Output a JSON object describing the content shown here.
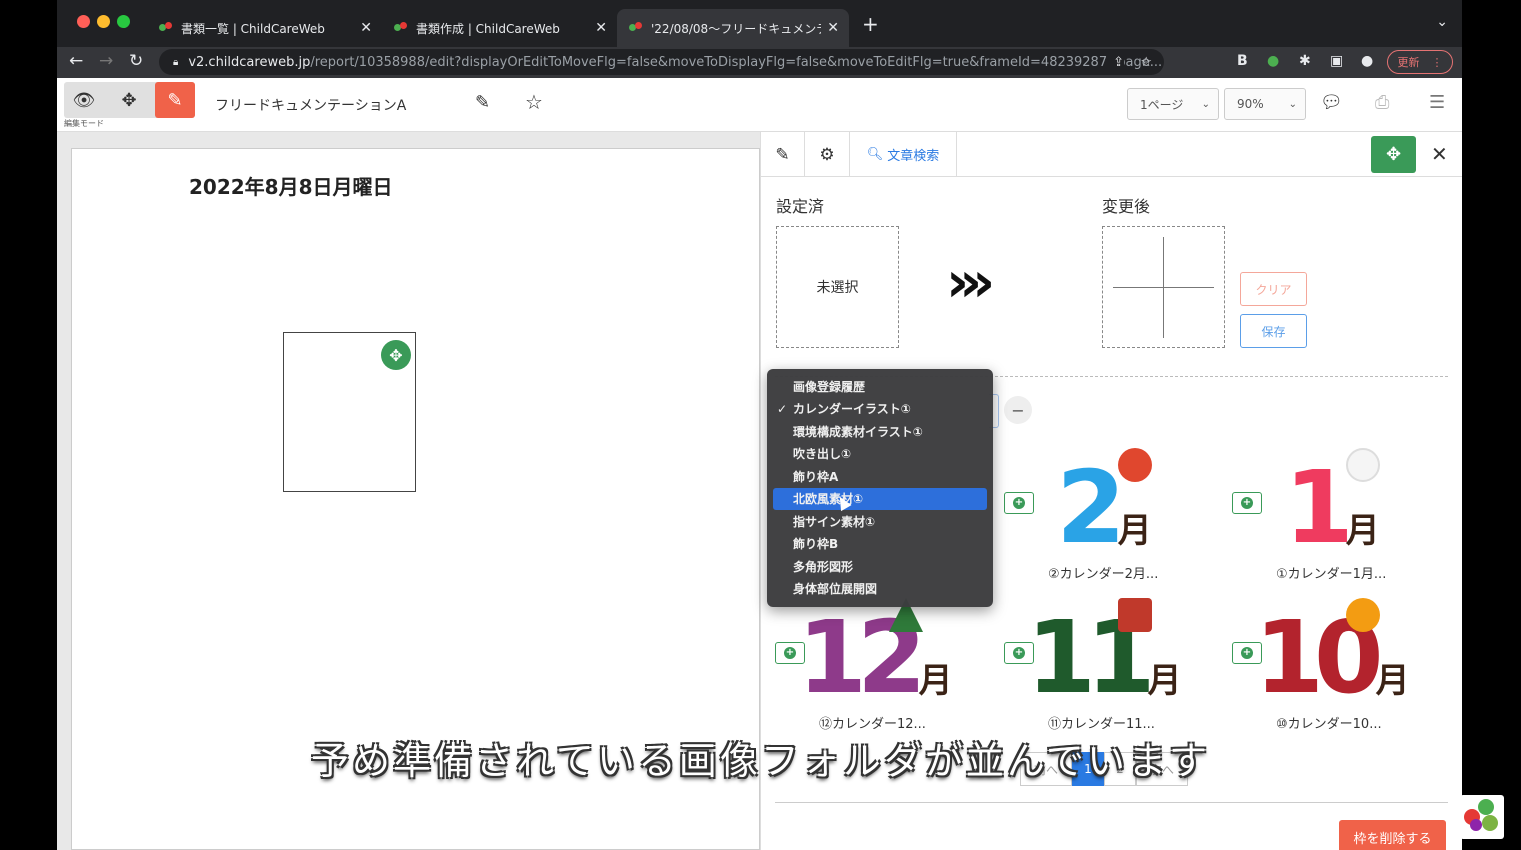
{
  "browser": {
    "tabs": [
      {
        "title": "書類一覧 | ChildCareWeb"
      },
      {
        "title": "書類作成 | ChildCareWeb"
      },
      {
        "title": "'22/08/08〜フリードキュメンテ"
      }
    ],
    "url_host": "v2.childcareweb.jp",
    "url_path": "/report/10358988/edit?displayOrEditToMoveFlg=false&moveToDisplayFlg=false&moveToEditFlg=true&frameId=48239287&page...",
    "update_label": "更新",
    "extensions": [
      "B"
    ]
  },
  "toolbar": {
    "mode_label": "編集モード",
    "doc_title": "フリードキュメンテーションA",
    "page_select": "1ページ",
    "zoom_select": "90%"
  },
  "canvas": {
    "date_heading": "2022年8月8日月曜日"
  },
  "panel": {
    "search_label": "文章検索",
    "set_label": "設定済",
    "after_label": "変更後",
    "unselected_label": "未選択",
    "arrows": "›››",
    "clear_label": "クリア",
    "save_label": "保存",
    "delete_frame_label": "枠を削除する"
  },
  "dropdown": {
    "items": [
      {
        "label": "画像登録履歴",
        "checked": false,
        "selected": false
      },
      {
        "label": "カレンダーイラスト①",
        "checked": true,
        "selected": false
      },
      {
        "label": "環境構成素材イラスト①",
        "checked": false,
        "selected": false
      },
      {
        "label": "吹き出し①",
        "checked": false,
        "selected": false
      },
      {
        "label": "飾り枠A",
        "checked": false,
        "selected": false
      },
      {
        "label": "北欧風素材①",
        "checked": false,
        "selected": true
      },
      {
        "label": "指サイン素材①",
        "checked": false,
        "selected": false
      },
      {
        "label": "飾り枠B",
        "checked": false,
        "selected": false
      },
      {
        "label": "多角形図形",
        "checked": false,
        "selected": false
      },
      {
        "label": "身体部位展開図",
        "checked": false,
        "selected": false
      }
    ]
  },
  "images": [
    {
      "label": "②カレンダー2月...",
      "numeral": "2",
      "color": "#2aa3e6"
    },
    {
      "label": "①カレンダー1月...",
      "numeral": "1",
      "color": "#ef3b5f"
    },
    {
      "label": "⑫カレンダー12...",
      "numeral": "12",
      "color": "#8e3a8a"
    },
    {
      "label": "⑪カレンダー11...",
      "numeral": "11",
      "color": "#1f5a2c"
    },
    {
      "label": "⑩カレンダー10...",
      "numeral": "10",
      "color": "#b3232d"
    }
  ],
  "month_char": "月",
  "pagination": [
    "前へ",
    "1",
    "2",
    "次へ"
  ],
  "subtitle": "予め準備されている画像フォルダが並んでいます",
  "colors": {
    "accent_green": "#3a9a58",
    "accent_red": "#f06249",
    "accent_blue": "#2a7ae2"
  }
}
